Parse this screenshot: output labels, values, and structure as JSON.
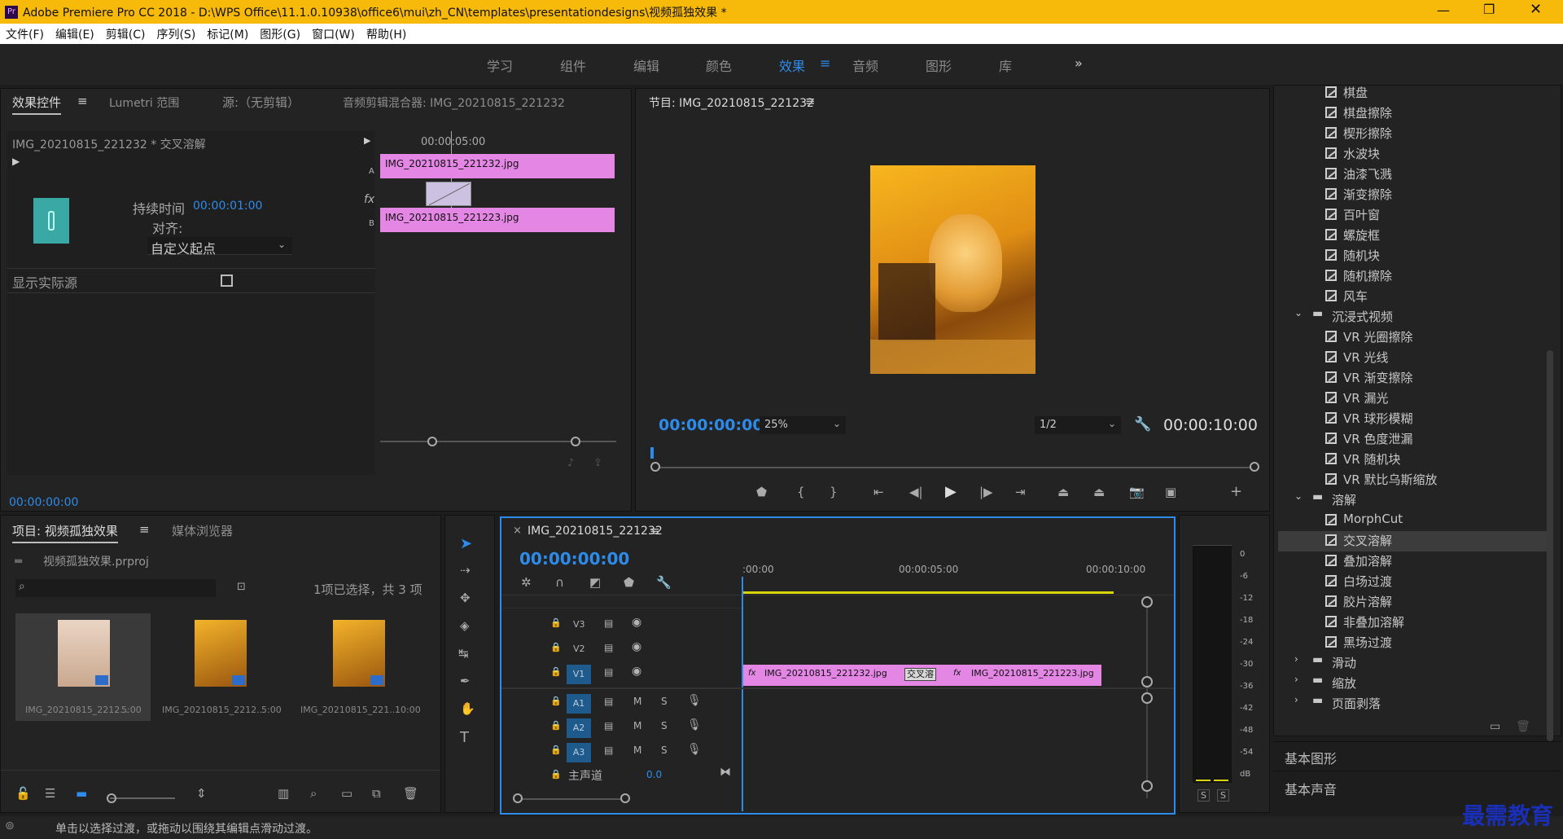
{
  "window": {
    "title": "Adobe Premiere Pro CC 2018 - D:\\WPS Office\\11.1.0.10938\\office6\\mui\\zh_CN\\templates\\presentationdesigns\\视频孤独效果 *",
    "app_badge": "Pr"
  },
  "menu": [
    "文件(F)",
    "编辑(E)",
    "剪辑(C)",
    "序列(S)",
    "标记(M)",
    "图形(G)",
    "窗口(W)",
    "帮助(H)"
  ],
  "workspaces": {
    "items": [
      "学习",
      "组件",
      "编辑",
      "颜色",
      "效果",
      "音频",
      "图形",
      "库"
    ],
    "active": "效果",
    "more": "»"
  },
  "effect_controls": {
    "tabs": [
      "效果控件",
      "Lumetri 范围",
      "源:（无剪辑）",
      "音频剪辑混合器: IMG_20210815_221232"
    ],
    "clip_header": "IMG_20210815_221232 * 交叉溶解",
    "duration_label": "持续时间",
    "duration_value": "00:00:01:00",
    "align_label": "对齐:",
    "align_value": "自定义起点",
    "show_source_label": "显示实际源",
    "mini_timecode": "00:00:05:00",
    "clip_a": "IMG_20210815_221232.jpg",
    "clip_b": "IMG_20210815_221223.jpg",
    "track_a": "A",
    "track_b": "B",
    "fx": "fx",
    "timecode": "00:00:00:00"
  },
  "program_monitor": {
    "title": "节目: IMG_20210815_221232",
    "timecode": "00:00:00:00",
    "zoom": "25%",
    "resolution": "1/2",
    "duration": "00:00:10:00"
  },
  "project": {
    "tabs": [
      "项目: 视频孤独效果",
      "媒体浏览器"
    ],
    "file": "视频孤独效果.prproj",
    "selection": "1项已选择，共 3 项",
    "items": [
      {
        "name": "IMG_20210815_2212...",
        "duration": "5:00"
      },
      {
        "name": "IMG_20210815_2212...",
        "duration": "5:00"
      },
      {
        "name": "IMG_20210815_221...",
        "duration": "10:00"
      }
    ]
  },
  "timeline": {
    "title": "IMG_20210815_221232",
    "close": "×",
    "timecode": "00:00:00:00",
    "ruler": [
      ":00:00",
      "00:00:05:00",
      "00:00:10:00"
    ],
    "video_tracks": [
      "V3",
      "V2",
      "V1"
    ],
    "audio_tracks": [
      "A1",
      "A2",
      "A3"
    ],
    "master": "主声道",
    "master_value": "0.0",
    "mute": "M",
    "solo": "S",
    "clip1": "IMG_20210815_221232.jpg",
    "clip2": "IMG_20210815_221223.jpg",
    "transition": "交叉溶",
    "fx": "fx"
  },
  "meter": {
    "ticks": [
      "0",
      "-6",
      "-12",
      "-18",
      "-24",
      "-30",
      "-36",
      "-42",
      "-48",
      "-54",
      "dB"
    ],
    "solo_left": "S",
    "solo_right": "S"
  },
  "effects_list": {
    "top_items": [
      "棋盘",
      "棋盘擦除",
      "楔形擦除",
      "水波块",
      "油漆飞溅",
      "渐变擦除",
      "百叶窗",
      "螺旋框",
      "随机块",
      "随机擦除",
      "风车"
    ],
    "folder_immersive": "沉浸式视频",
    "immersive_items": [
      "VR 光圈擦除",
      "VR 光线",
      "VR 渐变擦除",
      "VR 漏光",
      "VR 球形模糊",
      "VR 色度泄漏",
      "VR 随机块",
      "VR 默比乌斯缩放"
    ],
    "folder_dissolve": "溶解",
    "dissolve_items": [
      "MorphCut",
      "交叉溶解",
      "叠加溶解",
      "白场过渡",
      "胶片溶解",
      "非叠加溶解",
      "黑场过渡"
    ],
    "selected": "交叉溶解",
    "folders_after": [
      "滑动",
      "缩放",
      "页面剥落"
    ]
  },
  "side_panels": [
    "基本图形",
    "基本声音"
  ],
  "status": "单击以选择过渡，或拖动以围绕其编辑点滑动过渡。",
  "watermark": "最需教育",
  "colors": {
    "accent": "#2d8ceb",
    "clip": "#e486e4",
    "titlebar": "#f7b90a"
  }
}
